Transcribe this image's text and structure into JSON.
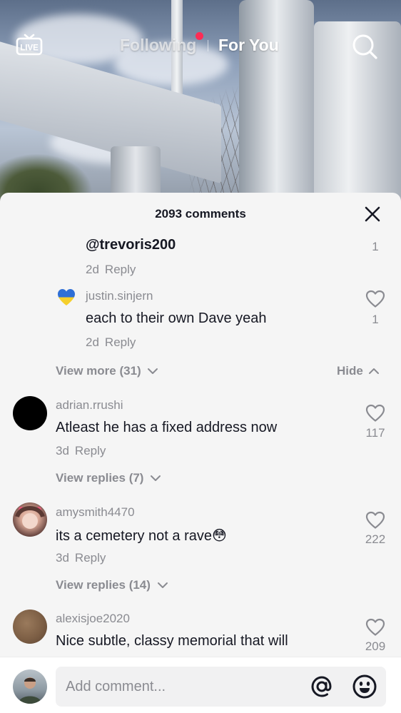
{
  "nav": {
    "live_label": "LIVE",
    "following": "Following",
    "for_you": "For You"
  },
  "sheet": {
    "title": "2093 comments"
  },
  "replies": [
    {
      "mention": "@trevoris200",
      "age": "2d",
      "reply": "Reply",
      "likes": "1"
    },
    {
      "username": "justin.sinjern",
      "text": "each to their own Dave yeah",
      "age": "2d",
      "reply": "Reply",
      "likes": "1",
      "avatar_icon": "ukraine-heart-icon"
    }
  ],
  "reply_controls": {
    "view_more": "View more (31)",
    "hide": "Hide"
  },
  "comments": [
    {
      "username": "adrian.rrushi",
      "text": "Atleast he has a fixed address now",
      "age": "3d",
      "reply": "Reply",
      "likes": "117",
      "view_replies": "View replies (7)"
    },
    {
      "username": "amysmith4470",
      "text": "its a cemetery not a rave😳",
      "age": "3d",
      "reply": "Reply",
      "likes": "222",
      "view_replies": "View replies (14)"
    },
    {
      "username": "alexisjoe2020",
      "text": "Nice subtle, classy memorial that will",
      "likes": "209"
    }
  ],
  "composer": {
    "placeholder": "Add comment...",
    "at_icon": "at-icon",
    "emoji_icon": "emoji-icon"
  },
  "colors": {
    "accent": "#fe2c55",
    "text_primary": "#161823",
    "text_secondary": "#8a8b91",
    "sheet_bg": "#f5f5f5"
  }
}
